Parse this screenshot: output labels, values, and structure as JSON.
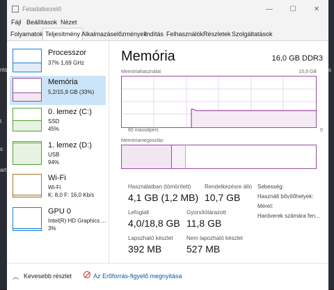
{
  "window": {
    "title": "Feladatkezelő"
  },
  "controls": {
    "minimize": "—",
    "maximize": "☐",
    "close": "✕"
  },
  "menu": [
    "Fájl",
    "Beállítások",
    "Nézet"
  ],
  "tabs": [
    "Folyamatok",
    "Teljesítmény",
    "Alkalmazáselőzmények",
    "Indítás",
    "Felhasználók",
    "Részletek",
    "Szolgáltatások"
  ],
  "active_tab": "Teljesítmény",
  "sidebar": [
    {
      "title": "Processzor",
      "sub1": "37% 1,69 GHz",
      "sub2": "",
      "sub3": "",
      "color": "#1b7fd4",
      "usage_percent": 37
    },
    {
      "title": "Memória",
      "sub1": "5,2/15,9 GB (33%)",
      "sub2": "",
      "sub3": "",
      "color": "#9b4aa0",
      "usage_percent": 33,
      "selected": true
    },
    {
      "title": "0. lemez (C:)",
      "sub1": "SSD",
      "sub2": "45%",
      "sub3": "",
      "color": "#4f9e2f",
      "usage_percent": 45
    },
    {
      "title": "1. lemez (D:)",
      "sub1": "USB",
      "sub2": "94%",
      "sub3": "",
      "color": "#4f9e2f",
      "usage_percent": 94
    },
    {
      "title": "Wi-Fi",
      "sub1": "Wi-Fi",
      "sub2": "K: 8,0  F: 16,0 Kb/s",
      "sub3": "",
      "color": "#a7772a",
      "usage_percent": 5
    },
    {
      "title": "GPU 0",
      "sub1": "Intel(R) HD Graphics ...",
      "sub2": "3%",
      "sub3": "",
      "color": "#1b7fd4",
      "usage_percent": 3
    }
  ],
  "main": {
    "heading": "Memória",
    "spec": "16,0 GB DDR3",
    "usage_caption": "Memóriahasználat",
    "usage_max": "15,9 GB",
    "time_caption": "60 másodperc",
    "zero": "0",
    "composition_caption": "Memóriamegoszlás",
    "accent": "#9b4aa0",
    "stats": [
      {
        "label": "Használatban (tömörített)",
        "value": "4,1 GB (1,2 MB)"
      },
      {
        "label": "Rendelkezésre álló",
        "value": "10,7 GB"
      },
      {
        "label": "Lefoglalt",
        "value": "4,0/18,8 GB"
      },
      {
        "label": "Gyorsítótárazott",
        "value": "11,8 GB"
      },
      {
        "label": "Lapozható készlet",
        "value": "392 MB"
      },
      {
        "label": "Nem lapozható készlet",
        "value": "527 MB"
      }
    ],
    "info": [
      "Sebesség:",
      "Használt bővítőhelyek:",
      "Méret:",
      "Hardverek számára fen..."
    ]
  },
  "status": {
    "fewer_details": "Kevesebb részlet",
    "resource_monitor": "Az Erőforrás-figyelő megnyitása"
  },
  "icons": {
    "app": "task-manager-icon",
    "chevron": "chevron-up-icon",
    "resource_monitor": "resource-monitor-icon"
  }
}
